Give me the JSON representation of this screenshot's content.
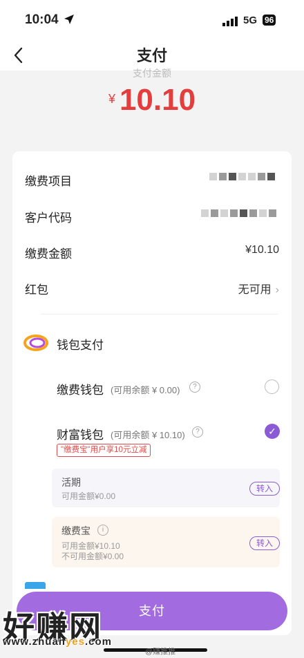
{
  "status_bar": {
    "time": "10:04",
    "network": "5G",
    "battery": "96"
  },
  "nav": {
    "title": "支付"
  },
  "amount": {
    "caption": "支付金额",
    "currency": "¥",
    "value": "10.10"
  },
  "details": {
    "item_label": "缴费项目",
    "customer_label": "客户代码",
    "fee_label": "缴费金额",
    "fee_value": "¥10.10",
    "redpacket_label": "红包",
    "redpacket_value": "无可用"
  },
  "wallet": {
    "title": "钱包支付",
    "fee_wallet": {
      "name": "缴费钱包",
      "balance": "(可用余额 ¥ 0.00)"
    },
    "wealth_wallet": {
      "name": "财富钱包",
      "balance": "(可用余额 ¥ 10.10)",
      "promo": "\"缴费宝\"用户享10元立减"
    },
    "current": {
      "title": "活期",
      "line1": "可用金额¥0.00",
      "transfer": "转入"
    },
    "bao": {
      "title": "缴费宝",
      "line1": "可用金额¥10.10",
      "line2": "不可用金额¥0.00",
      "transfer": "转入"
    }
  },
  "pay_button": {
    "label": "支付"
  },
  "watermark": {
    "brand": "好赚网",
    "url_start": "www.zhuan",
    "url_highlight": "yes",
    "url_end": ".com",
    "weibo": "@赚推推"
  },
  "colors": {
    "accent": "#a26be0",
    "price": "#e33d3d",
    "checked": "#8b5bd6"
  }
}
